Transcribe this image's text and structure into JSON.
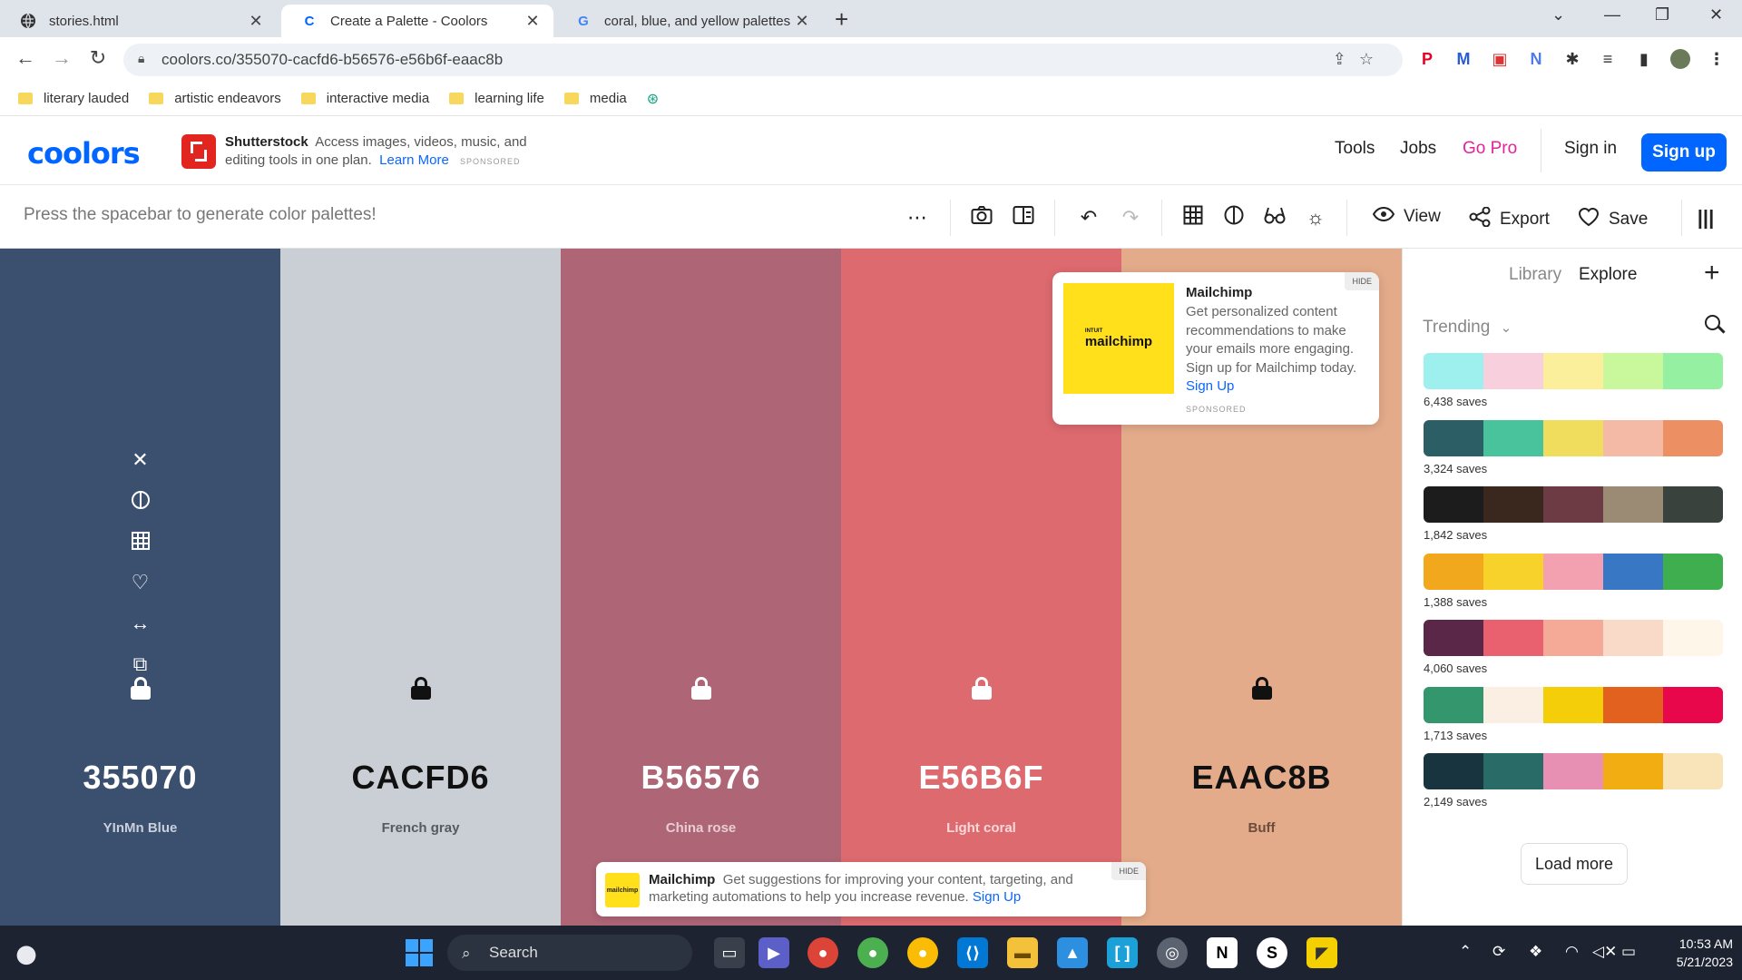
{
  "browser": {
    "tabs": [
      {
        "title": "stories.html"
      },
      {
        "title": "Create a Palette - Coolors"
      },
      {
        "title": "coral, blue, and yellow palettes -"
      }
    ],
    "url": "coolors.co/355070-cacfd6-b56576-e56b6f-eaac8b",
    "bookmarks": [
      "literary lauded",
      "artistic endeavors",
      "interactive media",
      "learning life",
      "media"
    ]
  },
  "header": {
    "logo": "coolors",
    "ad": {
      "brand": "Shutterstock",
      "text": "Access images, videos, music, and editing tools in one plan.",
      "link": "Learn More",
      "sponsored": "SPONSORED"
    },
    "nav": [
      "Tools",
      "Jobs",
      "Go Pro"
    ],
    "signin": "Sign in",
    "signup": "Sign up"
  },
  "toolbar": {
    "hint": "Press the spacebar to generate color palettes!",
    "view": "View",
    "export": "Export",
    "save": "Save"
  },
  "palette": [
    {
      "hex": "355070",
      "name": "YInMn Blue",
      "bg": "#3b4f6e",
      "text": "#ffffff",
      "sub": "#c9d0dc"
    },
    {
      "hex": "CACFD6",
      "name": "French gray",
      "bg": "#cacfd6",
      "text": "#111111",
      "sub": "#555a61"
    },
    {
      "hex": "B56576",
      "name": "China rose",
      "bg": "#ae6576",
      "text": "#ffffff",
      "sub": "#e8cdd3"
    },
    {
      "hex": "E56B6F",
      "name": "Light coral",
      "bg": "#dc6a6f",
      "text": "#ffffff",
      "sub": "#fbd8d9"
    },
    {
      "hex": "EAAC8B",
      "name": "Buff",
      "bg": "#e3ab8a",
      "text": "#111111",
      "sub": "#6b4c3b"
    }
  ],
  "ad_card": {
    "title": "Mailchimp",
    "body": "Get personalized content recommendations to make your emails more engaging. Sign up for Mailchimp today.",
    "cta": "Sign Up",
    "hide": "HIDE",
    "sponsored": "SPONSORED",
    "logo_text": "mailchimp",
    "logo_small": "INTUIT"
  },
  "ad_bar": {
    "title": "Mailchimp",
    "body": "Get suggestions for improving your content, targeting, and marketing automations to help you increase revenue.",
    "cta": "Sign Up",
    "hide": "HIDE",
    "logo_text": "mailchimp"
  },
  "sidebar": {
    "tabs": [
      "Library",
      "Explore"
    ],
    "filter": "Trending",
    "palettes": [
      {
        "colors": [
          "#9ef0ee",
          "#f8cfdc",
          "#fbef9c",
          "#c9f79b",
          "#95f0a1"
        ],
        "saves": "6,438 saves"
      },
      {
        "colors": [
          "#2c5f65",
          "#49c39c",
          "#f0dd5e",
          "#f5baa6",
          "#ec8f62"
        ],
        "saves": "3,324 saves"
      },
      {
        "colors": [
          "#1c1c1c",
          "#3a281e",
          "#6c3b44",
          "#9b8a74",
          "#3a423e"
        ],
        "saves": "1,842 saves"
      },
      {
        "colors": [
          "#f2a81d",
          "#f6d22a",
          "#f3a0b1",
          "#3877c3",
          "#3fae4f"
        ],
        "saves": "1,388 saves"
      },
      {
        "colors": [
          "#5a2749",
          "#e9606f",
          "#f4aa97",
          "#f9dac9",
          "#fdf6e9"
        ],
        "saves": "4,060 saves"
      },
      {
        "colors": [
          "#34966d",
          "#fbeee3",
          "#f5ce0a",
          "#e2611f",
          "#e8074a"
        ],
        "saves": "1,713 saves"
      },
      {
        "colors": [
          "#18343f",
          "#296c67",
          "#e88fb4",
          "#f2ad13",
          "#f9e3b9"
        ],
        "saves": "2,149 saves"
      }
    ],
    "load_more": "Load more"
  },
  "taskbar": {
    "search": "Search",
    "time": "10:53 AM",
    "date": "5/21/2023"
  }
}
